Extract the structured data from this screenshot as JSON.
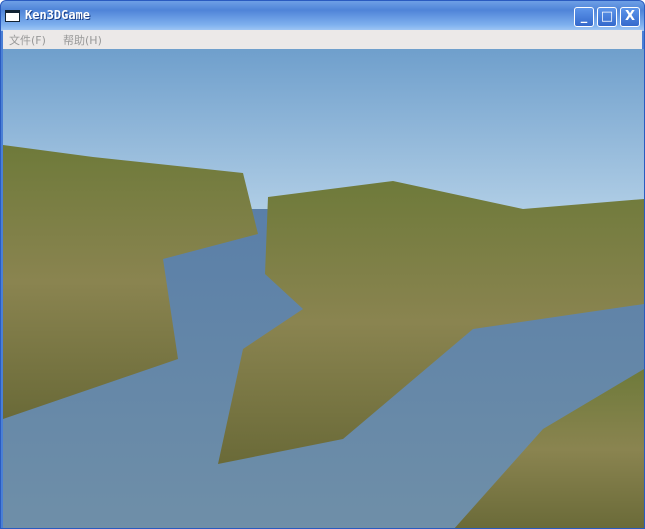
{
  "window": {
    "title": "Ken3DGame"
  },
  "menu": [
    {
      "label": "文件(F)"
    },
    {
      "label": "帮助(H)"
    }
  ],
  "controls": {
    "minimize": "_",
    "maximize": "□",
    "close": "X"
  }
}
